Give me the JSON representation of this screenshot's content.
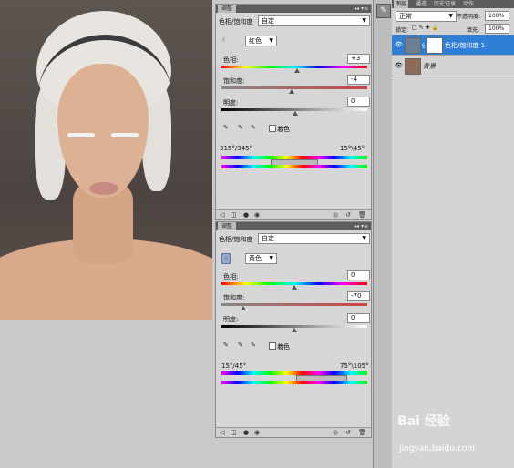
{
  "panel1": {
    "tab_label": "调整",
    "adjustment_name": "色相/饱和度",
    "preset_value": "自定",
    "channel_value": "红色",
    "hue_label": "色相:",
    "hue_value": "+3",
    "saturation_label": "饱和度:",
    "saturation_value": "-4",
    "lightness_label": "明度:",
    "lightness_value": "0",
    "colorize_label": "着色",
    "range_left": "315°/345°",
    "range_right": "15°\\45°"
  },
  "panel2": {
    "tab_label": "调整",
    "adjustment_name": "色相/饱和度",
    "preset_value": "自定",
    "channel_value": "黄色",
    "hue_label": "色相:",
    "hue_value": "0",
    "saturation_label": "饱和度:",
    "saturation_value": "-70",
    "lightness_label": "明度:",
    "lightness_value": "0",
    "colorize_label": "着色",
    "range_left": "15°/45°",
    "range_right": "75°\\105°"
  },
  "layers": {
    "tabs": [
      "图层",
      "通道",
      "历史记录",
      "动作"
    ],
    "blend_mode": "正常",
    "opacity_label": "不透明度:",
    "opacity_value": "100%",
    "lock_label": "锁定:",
    "fill_label": "填充:",
    "fill_value": "100%",
    "items": [
      {
        "name": "色相/饱和度 1",
        "selected": true
      },
      {
        "name": "背景",
        "selected": false
      }
    ]
  },
  "watermark": {
    "brand": "Bai 经验",
    "url": "jingyan.baidu.com"
  },
  "colors": {
    "selected_layer": "#2f7fd6",
    "panel_bg": "#d6d6d6"
  }
}
